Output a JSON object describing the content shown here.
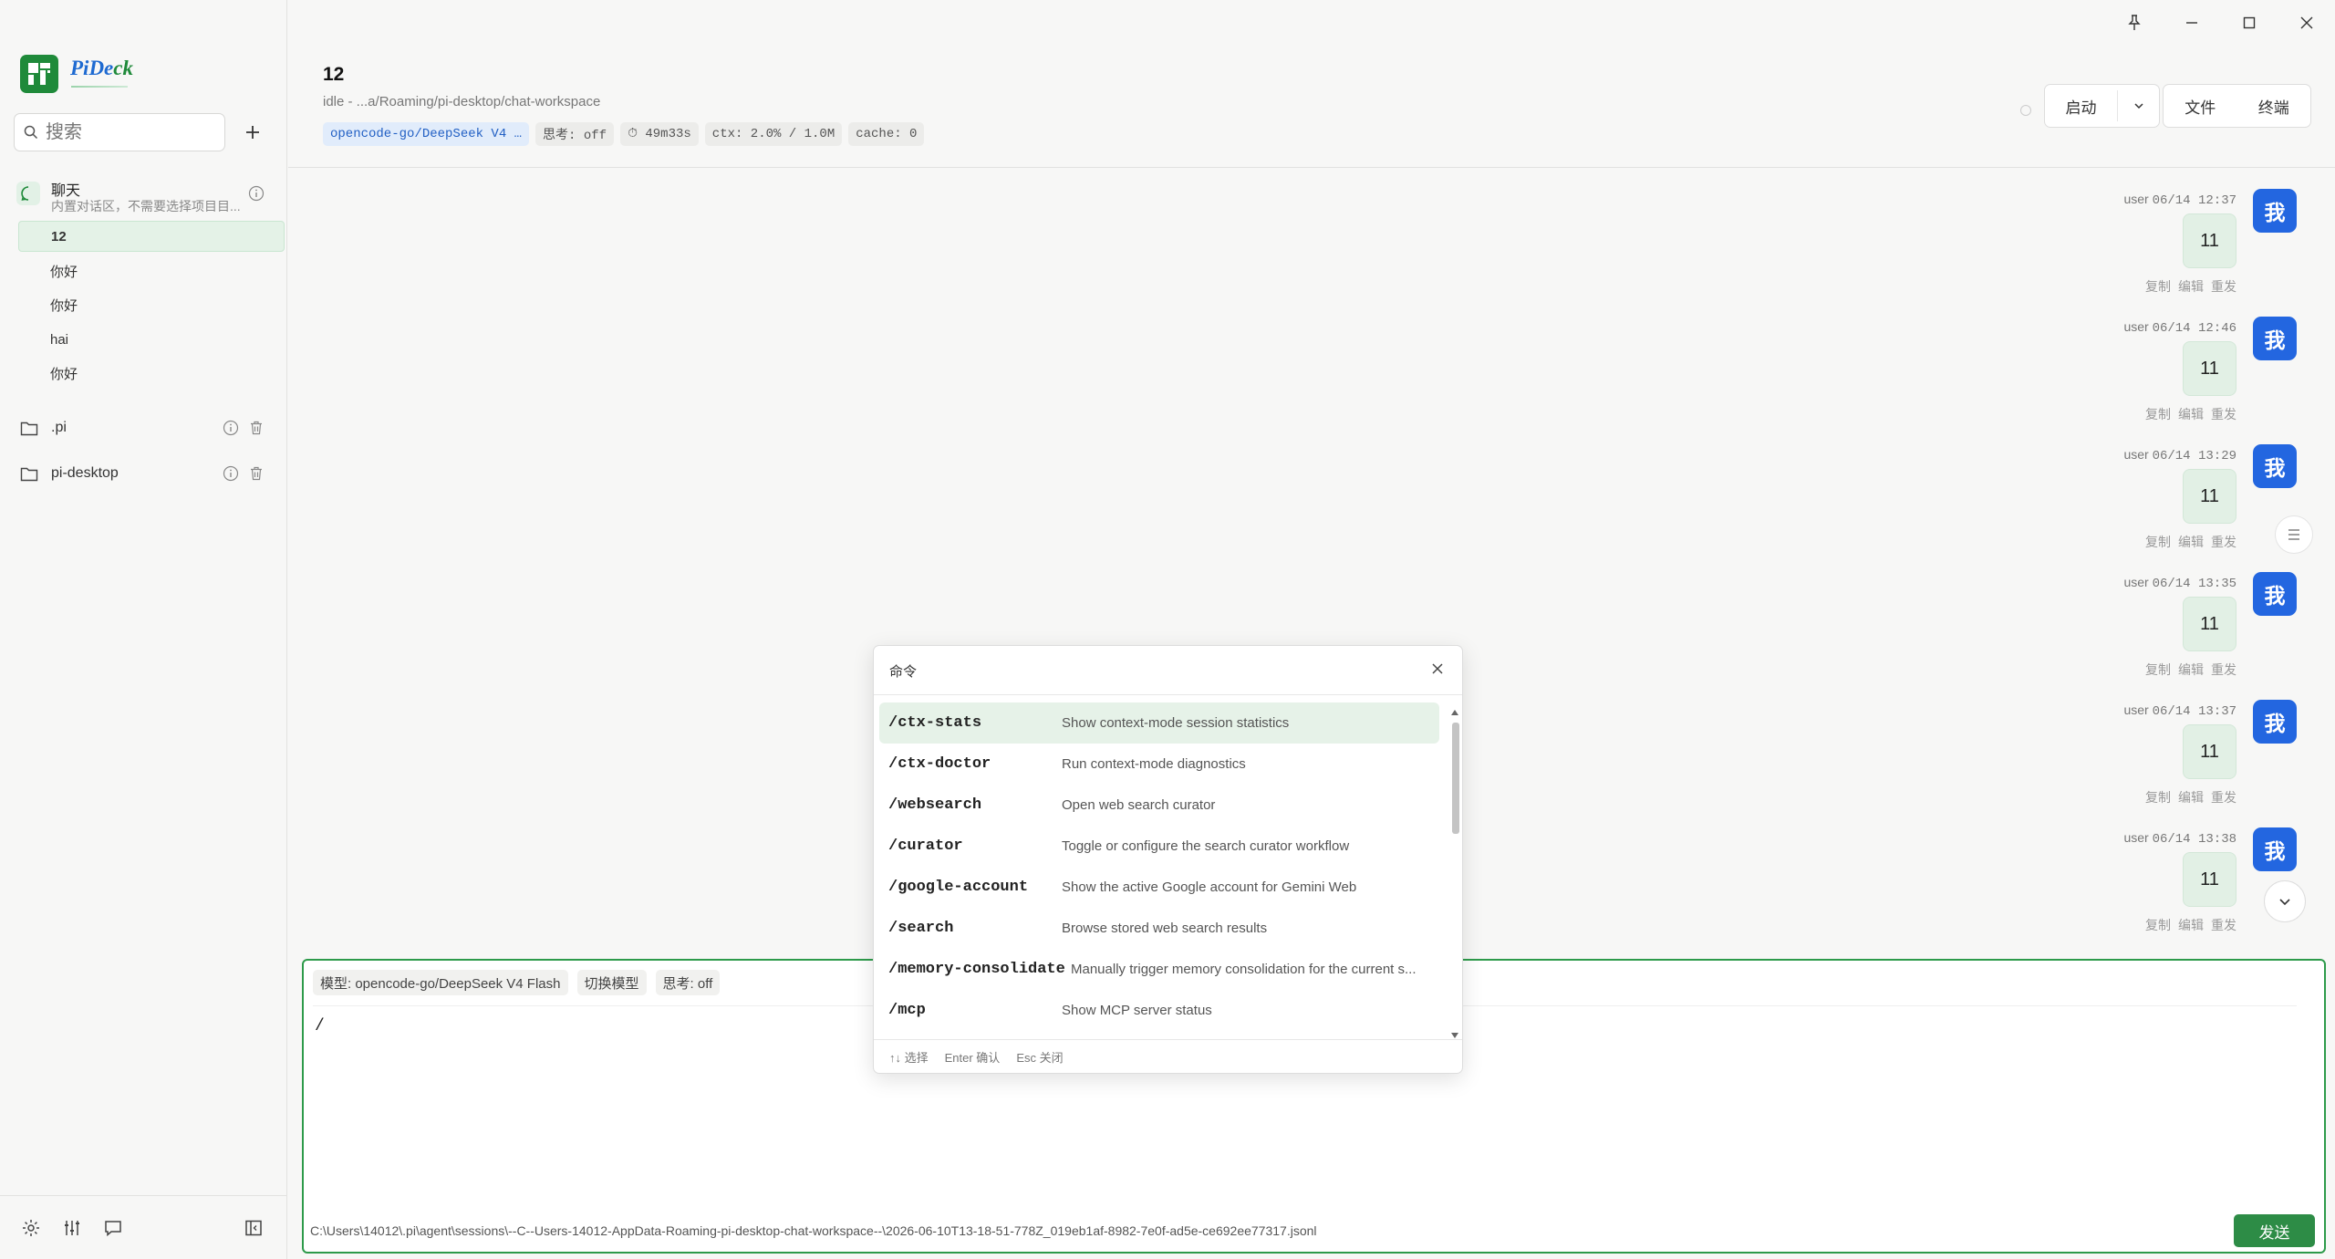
{
  "app": {
    "name_part1": "PiDe",
    "name_part2": "ck"
  },
  "sidebar": {
    "search_placeholder": "搜索",
    "chat_group": {
      "title": "聊天",
      "subtitle": "内置对话区，不需要选择项目目..."
    },
    "sessions": [
      {
        "label": "12",
        "active": true
      },
      {
        "label": "你好"
      },
      {
        "label": "你好"
      },
      {
        "label": "hai"
      },
      {
        "label": "你好"
      }
    ],
    "folders": [
      {
        "label": ".pi"
      },
      {
        "label": "pi-desktop"
      }
    ]
  },
  "header": {
    "title": "12",
    "path": "idle - ...a/Roaming/pi-desktop/chat-workspace",
    "tags": {
      "model": "opencode-go/DeepSeek V4 …",
      "thinking": "思考: off",
      "duration": "⏱ 49m33s",
      "ctx": "ctx: 2.0% / 1.0M",
      "cache": "cache: 0"
    },
    "start_label": "启动",
    "files_label": "文件",
    "terminal_label": "终端"
  },
  "messages": [
    {
      "role": "user",
      "time": "06/14 12:37",
      "text": "11",
      "avatar": "我"
    },
    {
      "role": "user",
      "time": "06/14 12:46",
      "text": "11",
      "avatar": "我"
    },
    {
      "role": "user",
      "time": "06/14 13:29",
      "text": "11",
      "avatar": "我"
    },
    {
      "role": "user",
      "time": "06/14 13:35",
      "text": "11",
      "avatar": "我"
    },
    {
      "role": "user",
      "time": "06/14 13:37",
      "text": "11",
      "avatar": "我"
    },
    {
      "role": "user",
      "time": "06/14 13:38",
      "text": "11",
      "avatar": "我"
    }
  ],
  "message_actions": {
    "copy": "复制",
    "edit": "编辑",
    "resend": "重发"
  },
  "composer": {
    "model_chip": "模型: opencode-go/DeepSeek V4 Flash",
    "switch_chip": "切换模型",
    "thinking_chip": "思考: off",
    "value": "/",
    "file_path": "C:\\Users\\14012\\.pi\\agent\\sessions\\--C--Users-14012-AppData-Roaming-pi-desktop-chat-workspace--\\2026-06-10T13-18-51-778Z_019eb1af-8982-7e0f-ad5e-ce692ee77317.jsonl",
    "send_label": "发送"
  },
  "palette": {
    "title": "命令",
    "commands": [
      {
        "cmd": "/ctx-stats",
        "desc": "Show context-mode session statistics",
        "selected": true
      },
      {
        "cmd": "/ctx-doctor",
        "desc": "Run context-mode diagnostics"
      },
      {
        "cmd": "/websearch",
        "desc": "Open web search curator"
      },
      {
        "cmd": "/curator",
        "desc": "Toggle or configure the search curator workflow"
      },
      {
        "cmd": "/google-account",
        "desc": "Show the active Google account for Gemini Web"
      },
      {
        "cmd": "/search",
        "desc": "Browse stored web search results"
      },
      {
        "cmd": "/memory-consolidate",
        "desc": "Manually trigger memory consolidation for the current s..."
      },
      {
        "cmd": "/mcp",
        "desc": "Show MCP server status"
      }
    ],
    "footer": {
      "select": "↑↓ 选择",
      "confirm": "Enter 确认",
      "close": "Esc 关闭"
    }
  },
  "colors": {
    "accent_green": "#2d8c46",
    "avatar_blue": "#2366e0",
    "bubble_green": "#e2f0e5"
  },
  "icons": [
    "pin-icon",
    "minimize-icon",
    "maximize-icon",
    "close-icon",
    "search-icon",
    "plus-icon",
    "chat-icon",
    "info-icon",
    "folder-icon",
    "trash-icon",
    "settings-icon",
    "sliders-icon",
    "message-icon",
    "sidebar-toggle-icon",
    "chevron-down-icon",
    "list-icon"
  ]
}
